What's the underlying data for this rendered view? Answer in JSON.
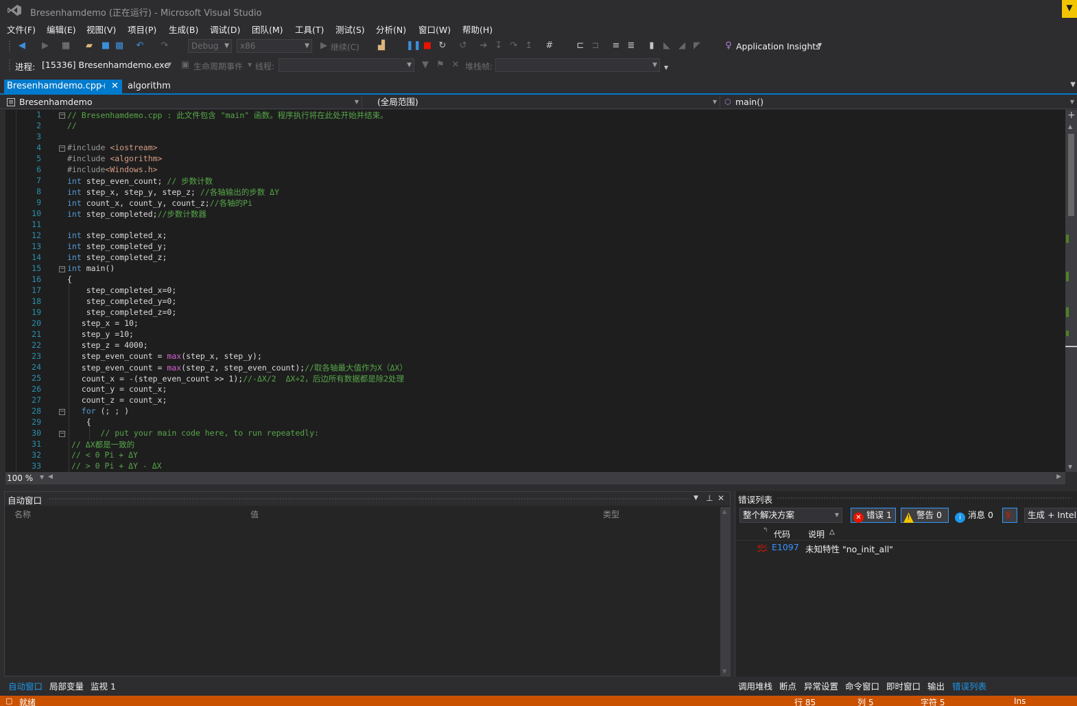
{
  "window": {
    "title": "Bresenhamdemo (正在运行) - Microsoft Visual Studio",
    "corner_badge": "▼"
  },
  "menu": [
    "文件(F)",
    "编辑(E)",
    "视图(V)",
    "项目(P)",
    "生成(B)",
    "调试(D)",
    "团队(M)",
    "工具(T)",
    "测试(S)",
    "分析(N)",
    "窗口(W)",
    "帮助(H)"
  ],
  "toolbar": {
    "config": "Debug",
    "platform": "x86",
    "continue_label": "继续(C)",
    "app_insights": "Application Insights"
  },
  "debug_toolbar": {
    "process_label": "进程:",
    "process_value": "[15336] Bresenhamdemo.exe",
    "lifecycle_label": "生命周期事件",
    "thread_label": "线程:",
    "stackframe_label": "堆栈帧:"
  },
  "tabs": [
    {
      "label": "Bresenhamdemo.cpp",
      "active": true
    },
    {
      "label": "algorithm",
      "active": false
    }
  ],
  "navbar": {
    "project": "Bresenhamdemo",
    "scope": "(全局范围)",
    "member": "main()"
  },
  "editor": {
    "zoom": "100 %",
    "lines": [
      {
        "n": "1"
      },
      {
        "n": "2"
      },
      {
        "n": "3"
      },
      {
        "n": "4"
      },
      {
        "n": "5"
      },
      {
        "n": "6"
      },
      {
        "n": "7"
      },
      {
        "n": "8"
      },
      {
        "n": "9"
      },
      {
        "n": "10"
      },
      {
        "n": "11"
      },
      {
        "n": "12"
      },
      {
        "n": "13"
      },
      {
        "n": "14"
      },
      {
        "n": "15"
      },
      {
        "n": "16"
      },
      {
        "n": "17"
      },
      {
        "n": "18"
      },
      {
        "n": "19"
      },
      {
        "n": "20"
      },
      {
        "n": "21"
      },
      {
        "n": "22"
      },
      {
        "n": "23"
      },
      {
        "n": "24"
      },
      {
        "n": "25"
      },
      {
        "n": "26"
      },
      {
        "n": "27"
      },
      {
        "n": "28"
      },
      {
        "n": "29"
      },
      {
        "n": "30"
      },
      {
        "n": "31"
      },
      {
        "n": "32"
      },
      {
        "n": "33"
      }
    ],
    "code": {
      "l1": "// Bresenhamdemo.cpp : 此文件包含 \"main\" 函数。程序执行将在此处开始并结束。",
      "l2": "//",
      "l4_pre": "#include ",
      "l4_hdr": "<iostream>",
      "l5_pre": "#include ",
      "l5_hdr": "<algorithm>",
      "l6_pre": "#include",
      "l6_hdr": "<Windows.h>",
      "int": "int",
      "l7_var": " step_even_count; ",
      "l7_cm": "// 步数计数",
      "l8_var": " step_x, step_y, step_z; ",
      "l8_cm": "//各轴输出的步数 ΔY",
      "l9_var": " count_x, count_y, count_z;",
      "l9_cm": "//各轴的Pi",
      "l10_var": " step_completed;",
      "l10_cm": "//步数计数器",
      "l12_var": " step_completed_x;",
      "l13_var": " step_completed_y;",
      "l14_var": " step_completed_z;",
      "l15_var": " main()",
      "l16": "{",
      "l17": "    step_completed_x=0;",
      "l18": "    step_completed_y=0;",
      "l19": "    step_completed_z=0;",
      "l20": "   step_x = 10;",
      "l21": "   step_y =10;",
      "l22": "   step_z = 4000;",
      "l23_a": "   step_even_count = ",
      "max": "max",
      "l23_b": "(step_x, step_y);",
      "l24_b": "(step_z, step_even_count);",
      "l24_cm": "//取各轴最大值作为X（ΔX）",
      "l25_a": "   count_x = -(step_even_count >> 1);",
      "l25_cm": "//-ΔX/2  ΔX÷2，后边所有数据都是除2处理",
      "l26": "   count_y = count_x;",
      "l27": "   count_z = count_x;",
      "for": "for",
      "l28_b": " (; ; )",
      "l29": "    {",
      "l30": "       // put your main code here, to run repeatedly:",
      "l31": "// ΔX都是一致的",
      "l32": "// < 0 Pi + ΔY",
      "l33": "// > 0 Pi + ΔY - ΔX"
    }
  },
  "autos": {
    "title": "自动窗口",
    "columns": [
      "名称",
      "值",
      "类型"
    ]
  },
  "errors": {
    "title": "错误列表",
    "scope": "整个解决方案",
    "errors_label": "错误 1",
    "warnings_label": "警告 0",
    "messages_label": "消息 0",
    "build_filter": "生成 + Intelli",
    "columns": [
      "代码",
      "说明"
    ],
    "rows": [
      {
        "code": "E1097",
        "description": "未知特性 \"no_init_all\""
      }
    ]
  },
  "bottom_tabs_left": [
    "自动窗口",
    "局部变量",
    "监视 1"
  ],
  "bottom_tabs_right": [
    "调用堆栈",
    "断点",
    "异常设置",
    "命令窗口",
    "即时窗口",
    "输出",
    "错误列表"
  ],
  "status": {
    "ready": "就绪",
    "row": "行 85",
    "col": "列 5",
    "char": "字符 5",
    "mode": "Ins"
  },
  "colors": {
    "accent": "#007acc",
    "status_debug": "#ca5100",
    "editor_bg": "#1e1e1e"
  }
}
